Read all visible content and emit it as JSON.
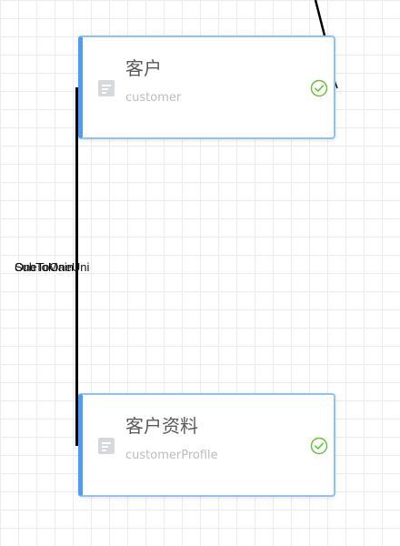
{
  "diagram": {
    "nodes": [
      {
        "title": "客户",
        "subtitle": "customer",
        "icon": "table-icon",
        "status_icon": "check-circle-icon"
      },
      {
        "title": "客户资料",
        "subtitle": "customerProfile",
        "icon": "table-icon",
        "status_icon": "check-circle-icon"
      }
    ],
    "edge_labels": [
      "OneToOneUni",
      "SubToMain"
    ],
    "colors": {
      "node_border": "#8ec3f4",
      "node_accent": "#4e9df0",
      "check": "#67c23a",
      "edge": "#000000"
    }
  }
}
